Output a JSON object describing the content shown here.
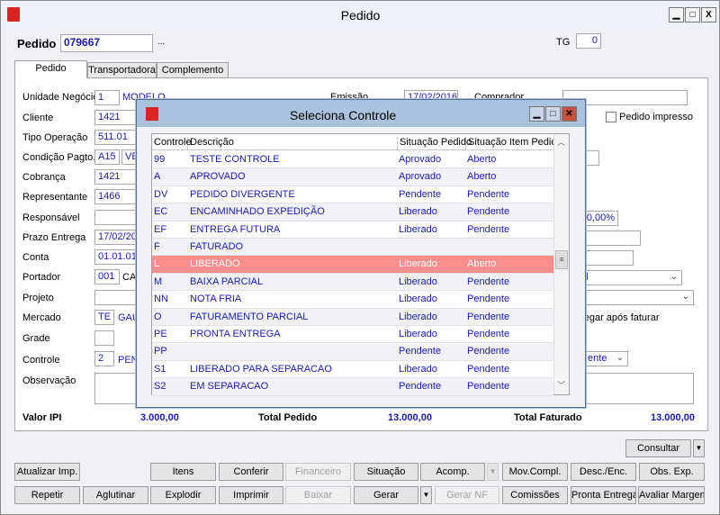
{
  "window": {
    "title": "Pedido",
    "controls": [
      "minimize",
      "maximize",
      "close"
    ]
  },
  "header": {
    "pedido_label": "Pedido",
    "pedido_value": "079667",
    "lookup_label": "...",
    "tg_label": "TG",
    "tg_value": "0"
  },
  "tabs": [
    {
      "label": "Pedido",
      "active": true
    },
    {
      "label": "Transportadora"
    },
    {
      "label": "Complemento"
    }
  ],
  "form": {
    "unidade": {
      "label": "Unidade Negócio",
      "value": "1",
      "desc": "MODELO"
    },
    "cliente": {
      "label": "Cliente",
      "value": "1421"
    },
    "tipo_operacao": {
      "label": "Tipo Operação",
      "value": "511.01"
    },
    "condicao": {
      "label": "Condição Pagto.",
      "value": "A15",
      "desc": "VEN"
    },
    "cobranca": {
      "label": "Cobrança",
      "value": "1421"
    },
    "representante": {
      "label": "Representante",
      "value": "1466"
    },
    "responsavel": {
      "label": "Responsável",
      "value": ""
    },
    "prazo": {
      "label": "Prazo Entrega",
      "value": "17/02/201"
    },
    "conta": {
      "label": "Conta",
      "value": "01.01.01"
    },
    "portador": {
      "label": "Portador",
      "value": "001",
      "desc": "CA"
    },
    "projeto": {
      "label": "Projeto",
      "value": ""
    },
    "mercado": {
      "label": "Mercado",
      "value": "TE",
      "desc": "GAÚ"
    },
    "grade": {
      "label": "Grade",
      "value": ""
    },
    "controle": {
      "label": "Controle",
      "value": "2",
      "desc": "PEN"
    },
    "observacao": {
      "label": "Observação",
      "value": ""
    },
    "emissao": {
      "label": "Emissão",
      "value": "17/02/2016"
    },
    "comprador": {
      "label": "Comprador",
      "value": ""
    },
    "pedido_impresso": {
      "label": "Pedido impresso",
      "checked": false
    },
    "percent": "10,00%",
    "select1": "al",
    "select3": "ente",
    "entregar_label": "tregar após faturar"
  },
  "totals": {
    "ipi_label": "Valor IPI",
    "ipi_value": "3.000,00",
    "pedido_label": "Total Pedido",
    "pedido_value": "13.000,00",
    "faturado_label": "Total Faturado",
    "faturado_value": "13.000,00"
  },
  "buttons": {
    "consultar": "Consultar",
    "row1": [
      {
        "label": "Atualizar Imp."
      },
      {
        "label": "Itens"
      },
      {
        "label": "Conferir"
      },
      {
        "label": "Financeiro",
        "disabled": true
      },
      {
        "label": "Situação"
      },
      {
        "label": "Acomp."
      },
      {
        "label": "Mov.Compl."
      },
      {
        "label": "Desc./Enc."
      },
      {
        "label": "Obs. Exp."
      }
    ],
    "row2": [
      {
        "label": "Repetir"
      },
      {
        "label": "Aglutinar"
      },
      {
        "label": "Explodir"
      },
      {
        "label": "Imprimir"
      },
      {
        "label": "Baixar",
        "disabled": true
      },
      {
        "label": "Gerar"
      },
      {
        "label": "Gerar NF",
        "disabled": true
      },
      {
        "label": "Comissões"
      },
      {
        "label": "Pronta Entrega"
      },
      {
        "label": "Avaliar Margem"
      }
    ]
  },
  "modal": {
    "title": "Seleciona Controle",
    "columns": [
      "Controle",
      "Descrição",
      "Situação Pedido",
      "Situação Item Pedido"
    ],
    "rows": [
      [
        "99",
        "TESTE CONTROLE",
        "Aprovado",
        "Aberto"
      ],
      [
        "A",
        "APROVADO",
        "Aprovado",
        "Aberto"
      ],
      [
        "DV",
        "PEDIDO DIVERGENTE",
        "Pendente",
        "Pendente"
      ],
      [
        "EC",
        "ENCAMINHADO EXPEDIÇÃO",
        "Liberado",
        "Pendente"
      ],
      [
        "EF",
        "ENTREGA FUTURA",
        "Liberado",
        "Pendente"
      ],
      [
        "F",
        "FATURADO",
        "",
        ""
      ],
      [
        "L",
        "LIBERADO",
        "Liberado",
        "Aberto"
      ],
      [
        "M",
        "BAIXA PARCIAL",
        "Liberado",
        "Pendente"
      ],
      [
        "NN",
        "NOTA FRIA",
        "Liberado",
        "Pendente"
      ],
      [
        "O",
        "FATURAMENTO PARCIAL",
        "Liberado",
        "Pendente"
      ],
      [
        "PE",
        "PRONTA ENTREGA",
        "Liberado",
        "Pendente"
      ],
      [
        "PP",
        "",
        "Pendente",
        "Pendente"
      ],
      [
        "S1",
        "LIBERADO PARA SEPARACAO",
        "Liberado",
        "Pendente"
      ],
      [
        "S2",
        "EM SEPARACAO",
        "Pendente",
        "Pendente"
      ]
    ],
    "selected_row": 6,
    "selected_color": "#fe8e8e"
  }
}
